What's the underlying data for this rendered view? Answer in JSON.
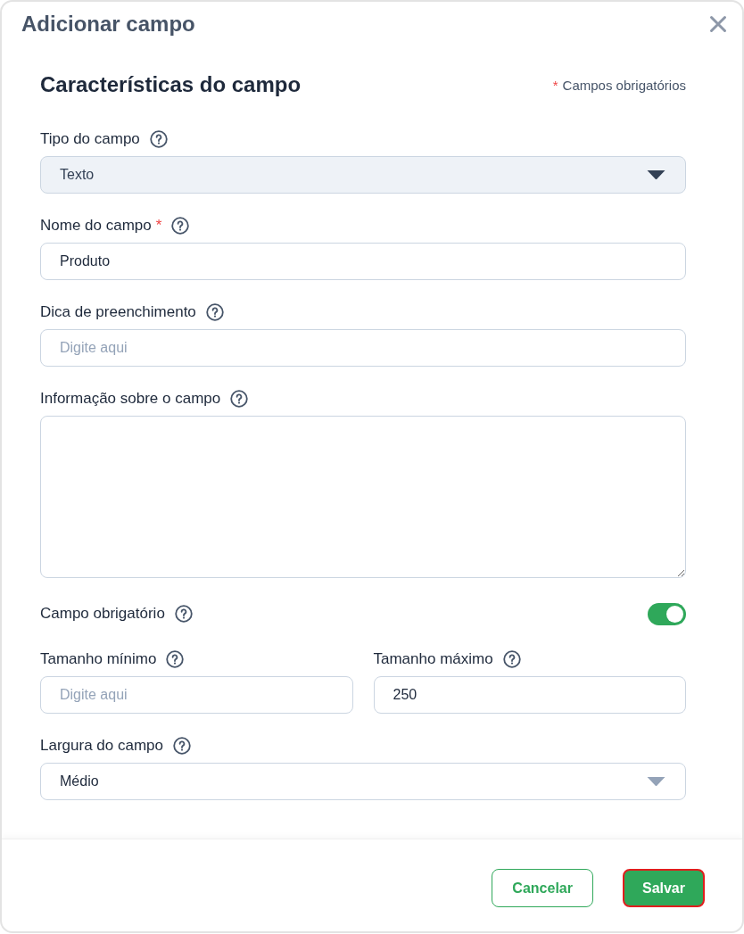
{
  "dialog": {
    "title": "Adicionar campo"
  },
  "section": {
    "title": "Características do campo",
    "required_note": {
      "mark": "*",
      "text": "Campos obrigatórios"
    }
  },
  "fields": [
    {
      "kind": "select",
      "label": "Tipo do campo",
      "value": "Texto",
      "disabled": true
    },
    {
      "kind": "input",
      "label": "Nome do campo",
      "required_mark": "*",
      "value": "Produto"
    },
    {
      "kind": "input",
      "label": "Dica de preenchimento",
      "placeholder": "Digite aqui"
    },
    {
      "kind": "textarea",
      "label": "Informação sobre o campo"
    },
    {
      "kind": "toggle",
      "label": "Campo obrigatório",
      "on": true
    },
    {
      "kind": "pair",
      "items": [
        {
          "label": "Tamanho mínimo",
          "placeholder": "Digite aqui"
        },
        {
          "label": "Tamanho máximo",
          "value": "250"
        }
      ]
    },
    {
      "kind": "select",
      "label": "Largura do campo",
      "value": "Médio",
      "disabled": false
    }
  ],
  "buttons": [
    {
      "label": "Cancelar",
      "kind": "secondary",
      "focused": false
    },
    {
      "label": "Salvar",
      "kind": "primary",
      "focused": true
    }
  ]
}
